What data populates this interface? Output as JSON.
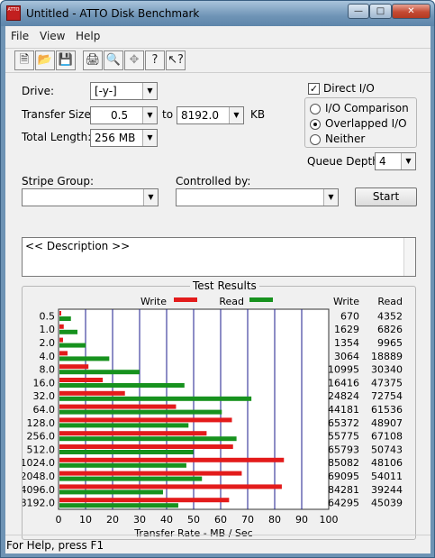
{
  "window": {
    "title": "Untitled - ATTO Disk Benchmark",
    "app_icon_text": "ATTO"
  },
  "menu": {
    "items": [
      "File",
      "View",
      "Help"
    ]
  },
  "toolbar": {
    "icons": [
      "new-icon",
      "open-icon",
      "save-icon",
      "print-icon",
      "print-preview-icon",
      "move-icon",
      "help-icon",
      "context-help-icon"
    ]
  },
  "form": {
    "drive_label": "Drive:",
    "drive_value": "[-y-]",
    "transfer_size_label": "Transfer Size:",
    "transfer_from": "0.5",
    "transfer_to_label": "to",
    "transfer_to": "8192.0",
    "transfer_unit": "KB",
    "total_length_label": "Total Length:",
    "total_length_value": "256 MB",
    "direct_io_label": "Direct I/O",
    "direct_io_checked": true,
    "io_options": [
      "I/O Comparison",
      "Overlapped I/O",
      "Neither"
    ],
    "io_selected": "Overlapped I/O",
    "queue_depth_label": "Queue Depth:",
    "queue_depth_value": "4",
    "stripe_group_label": "Stripe Group:",
    "controlled_by_label": "Controlled by:",
    "start_label": "Start",
    "description_text": "<< Description >>"
  },
  "status": {
    "text": "For Help, press F1"
  },
  "colors": {
    "write": "#e31b1b",
    "read": "#17921e",
    "grid": "#1b1b8c"
  },
  "chart_data": {
    "type": "bar",
    "title": "Test Results",
    "xlabel": "Transfer Rate - MB / Sec",
    "xlim": [
      0,
      100
    ],
    "x_ticks": [
      0,
      10,
      20,
      30,
      40,
      50,
      60,
      70,
      80,
      90,
      100
    ],
    "legend": [
      "Write",
      "Read"
    ],
    "column_headers": [
      "Write",
      "Read"
    ],
    "categories": [
      "0.5",
      "1.0",
      "2.0",
      "4.0",
      "8.0",
      "16.0",
      "32.0",
      "64.0",
      "128.0",
      "256.0",
      "512.0",
      "1024.0",
      "2048.0",
      "4096.0",
      "8192.0"
    ],
    "series": [
      {
        "name": "Write",
        "values_kbps": [
          670,
          1629,
          1354,
          3064,
          10995,
          16416,
          24824,
          44181,
          65372,
          55775,
          65793,
          85082,
          69095,
          84281,
          64295
        ]
      },
      {
        "name": "Read",
        "values_kbps": [
          4352,
          6826,
          9965,
          18889,
          30340,
          47375,
          72754,
          61536,
          48907,
          67108,
          50743,
          48106,
          54011,
          39244,
          45039
        ]
      }
    ]
  }
}
